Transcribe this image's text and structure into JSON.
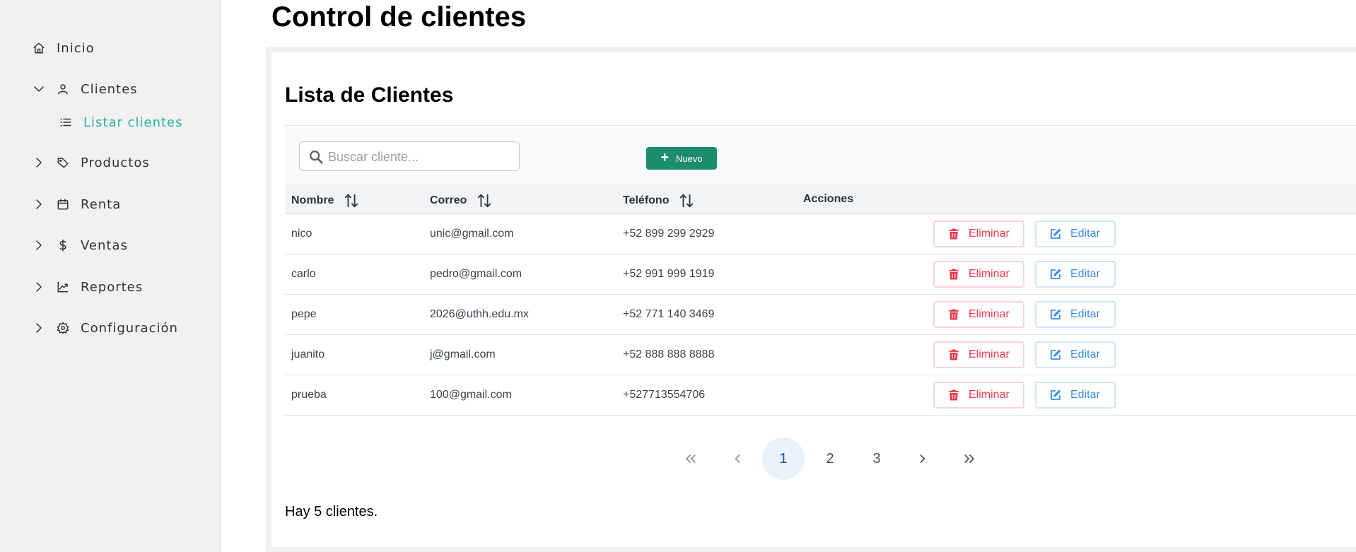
{
  "sidebar": {
    "items": [
      {
        "label": "Inicio",
        "icon": "home-icon"
      },
      {
        "label": "Clientes",
        "icon": "user-icon",
        "expanded": true
      },
      {
        "label": "Listar clientes",
        "icon": "list-icon",
        "active": true
      },
      {
        "label": "Productos",
        "icon": "tag-icon"
      },
      {
        "label": "Renta",
        "icon": "calendar-icon"
      },
      {
        "label": "Ventas",
        "icon": "dollar-icon"
      },
      {
        "label": "Reportes",
        "icon": "chart-line-icon"
      },
      {
        "label": "Configuración",
        "icon": "gear-icon"
      }
    ]
  },
  "page": {
    "title": "Control de clientes",
    "card_title": "Lista de Clientes"
  },
  "toolbar": {
    "search_placeholder": "Buscar cliente...",
    "search_value": "",
    "new_label": "Nuevo",
    "new_color": "#1b8c6c"
  },
  "table": {
    "headers": [
      "Nombre",
      "Correo",
      "Teléfono",
      "Acciones"
    ],
    "rows": [
      {
        "nombre": "nico",
        "correo": "unic@gmail.com",
        "telefono": "+52 899 299 2929"
      },
      {
        "nombre": "carlo",
        "correo": "pedro@gmail.com",
        "telefono": "+52 991 999 1919"
      },
      {
        "nombre": "pepe",
        "correo": "2026@uthh.edu.mx",
        "telefono": "+52 771 140 3469"
      },
      {
        "nombre": "juanito",
        "correo": "j@gmail.com",
        "telefono": "+52 888 888 8888"
      },
      {
        "nombre": "prueba",
        "correo": "100@gmail.com",
        "telefono": "+527713554706"
      }
    ],
    "delete_label": "Eliminar",
    "edit_label": "Editar",
    "delete_color": "#e83a4f",
    "edit_color": "#3a8fe8"
  },
  "pagination": {
    "pages": [
      "1",
      "2",
      "3"
    ],
    "current": "1"
  },
  "footer": {
    "count_text": "Hay 5 clientes."
  }
}
